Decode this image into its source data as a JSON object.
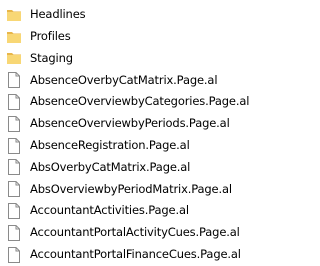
{
  "items": [
    {
      "type": "folder",
      "icon": "folder-icon",
      "label": "Headlines"
    },
    {
      "type": "folder",
      "icon": "folder-icon",
      "label": "Profiles"
    },
    {
      "type": "folder",
      "icon": "folder-icon",
      "label": "Staging"
    },
    {
      "type": "file",
      "icon": "file-icon",
      "label": "AbsenceOverbyCatMatrix.Page.al"
    },
    {
      "type": "file",
      "icon": "file-icon",
      "label": "AbsenceOverviewbyCategories.Page.al"
    },
    {
      "type": "file",
      "icon": "file-icon",
      "label": "AbsenceOverviewbyPeriods.Page.al"
    },
    {
      "type": "file",
      "icon": "file-icon",
      "label": "AbsenceRegistration.Page.al"
    },
    {
      "type": "file",
      "icon": "file-icon",
      "label": "AbsOverbyCatMatrix.Page.al"
    },
    {
      "type": "file",
      "icon": "file-icon",
      "label": "AbsOverviewbyPeriodMatrix.Page.al"
    },
    {
      "type": "file",
      "icon": "file-icon",
      "label": "AccountantActivities.Page.al"
    },
    {
      "type": "file",
      "icon": "file-icon",
      "label": "AccountantPortalActivityCues.Page.al"
    },
    {
      "type": "file",
      "icon": "file-icon",
      "label": "AccountantPortalFinanceCues.Page.al"
    }
  ],
  "colors": {
    "folder_fill": "#F8D775",
    "folder_tab": "#E8B64A",
    "file_stroke": "#8A8A8A",
    "file_fill": "#FFFFFF"
  }
}
